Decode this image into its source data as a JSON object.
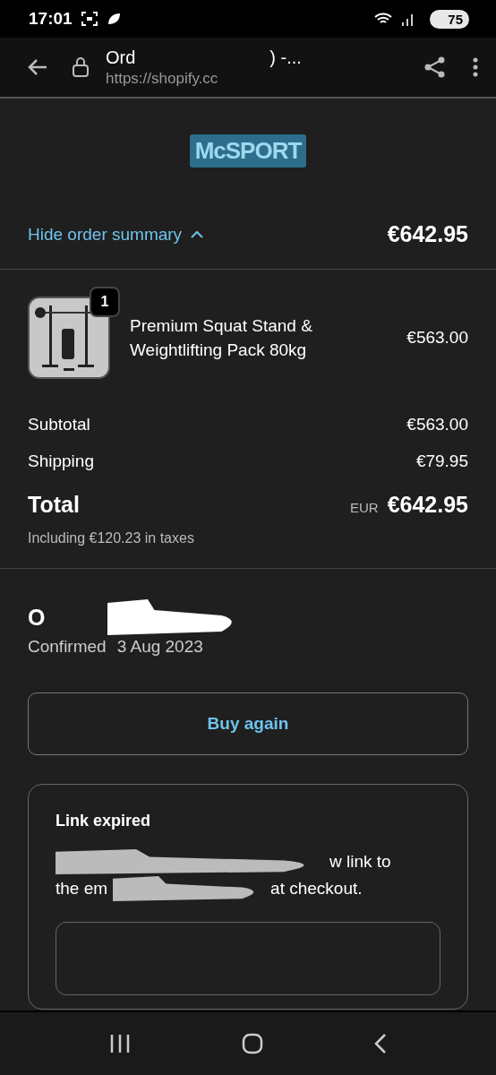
{
  "status_bar": {
    "time": "17:01",
    "battery": "75"
  },
  "browser": {
    "title_start": "Ord",
    "title_end": ") -...",
    "url": "https://shopify.cc"
  },
  "logo": {
    "text": "McSPORT"
  },
  "summary": {
    "toggle": "Hide order summary",
    "expanded": true,
    "total": "€642.95"
  },
  "items": [
    {
      "name": "Premium Squat Stand & Weightlifting Pack 80kg",
      "quantity": "1",
      "price": "€563.00",
      "kind": "picture"
    }
  ],
  "costs": [
    {
      "label": "Subtotal",
      "value": "€563.00"
    },
    {
      "label": "Shipping",
      "value": "€79.95"
    }
  ],
  "total": {
    "label": "Total",
    "currency": "EUR",
    "value": "€642.95",
    "taxes": "Including €120.23 in taxes"
  },
  "order": {
    "title": "O",
    "confirmed_start": "Confirmed",
    "confirmed_end": "3 Aug 2023"
  },
  "buy_again": "Buy again",
  "link_card": {
    "title": "Link expired",
    "line1_end": "w link to",
    "line2_start": "the em",
    "line2_end": "at checkout."
  },
  "nav": [
    {
      "kind": "recents"
    },
    {
      "kind": "home"
    },
    {
      "kind": "back"
    }
  ]
}
